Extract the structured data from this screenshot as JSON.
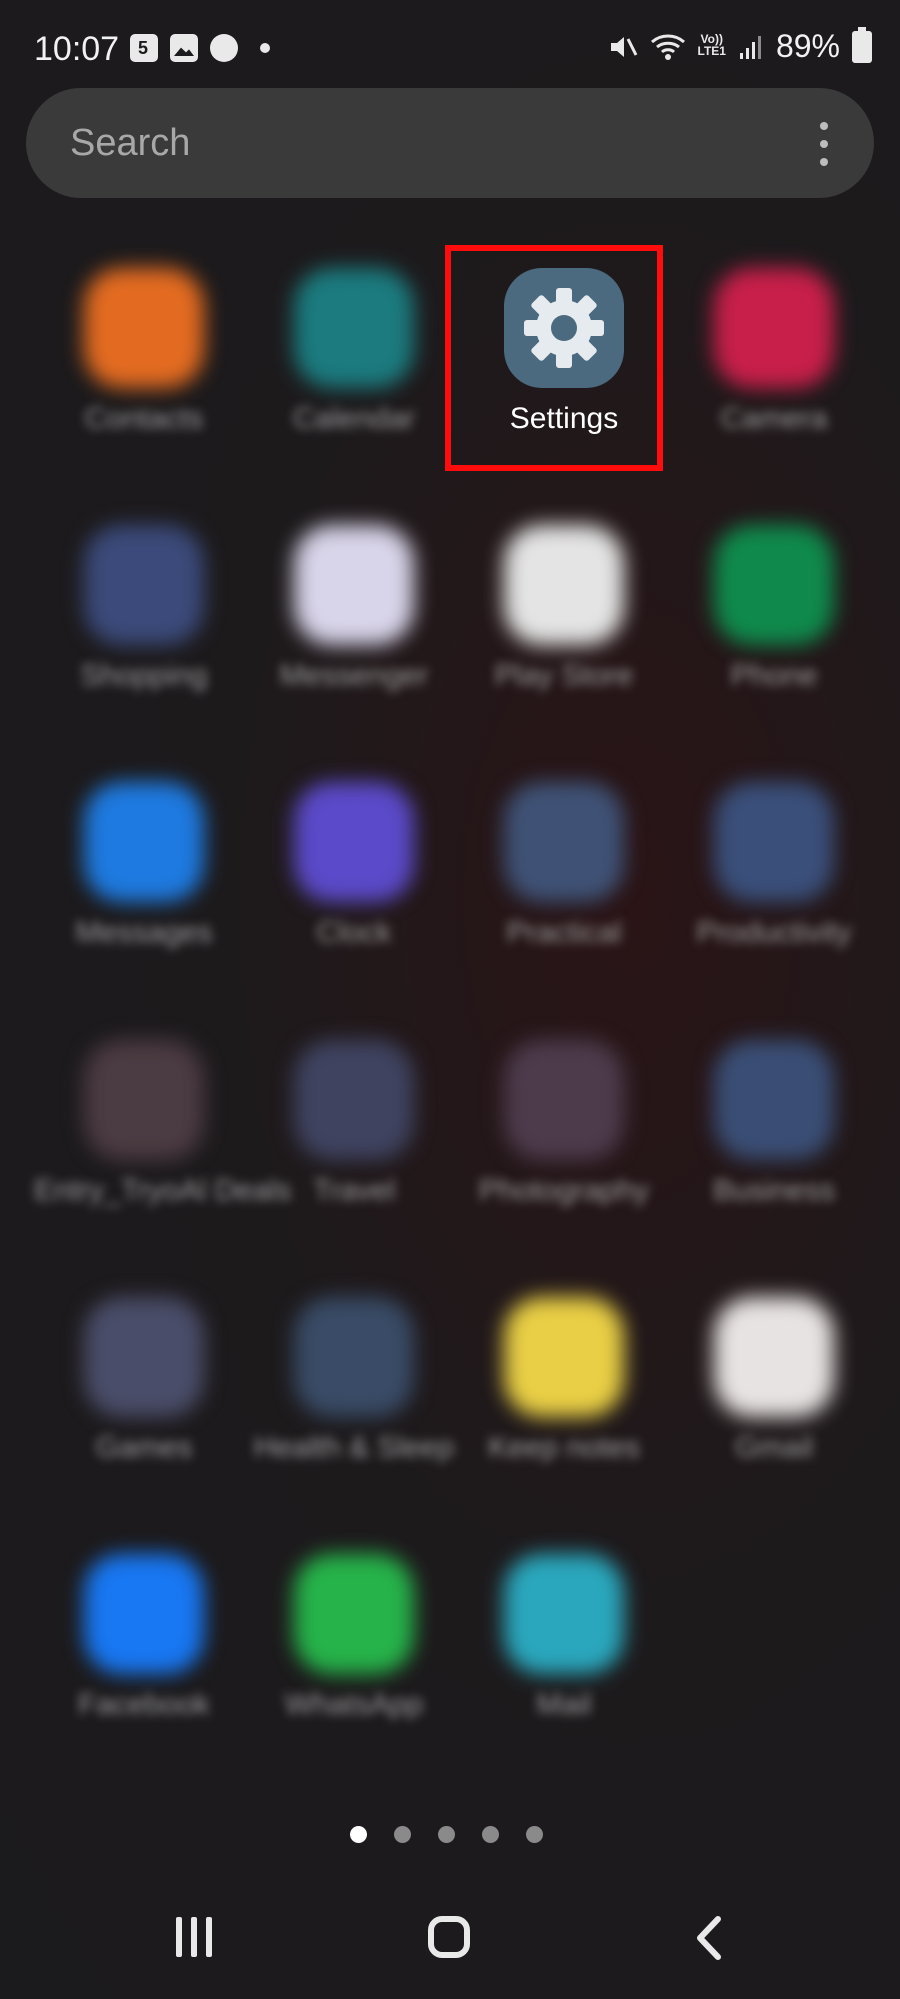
{
  "status_bar": {
    "time": "10:07",
    "calendar_day": "5",
    "lte_label_top": "Vo))",
    "lte_label_bottom": "LTE1",
    "battery": "89%"
  },
  "search": {
    "placeholder": "Search"
  },
  "apps": [
    {
      "label": "Contacts",
      "icon": "contacts-icon",
      "color": "#e36b21"
    },
    {
      "label": "Calendar",
      "icon": "calendar-icon",
      "color": "#1b7b7f"
    },
    {
      "label": "Settings",
      "icon": "gear-icon",
      "color": "#4b6a7f"
    },
    {
      "label": "Camera",
      "icon": "camera-icon",
      "color": "#c81f4a"
    },
    {
      "label": "Shopping",
      "icon": "folder-icon",
      "color": "#3b4a7a"
    },
    {
      "label": "Messenger",
      "icon": "messenger-icon",
      "color": "#d8d4e9"
    },
    {
      "label": "Play Store",
      "icon": "play-store-icon",
      "color": "#e4e4e4"
    },
    {
      "label": "Phone",
      "icon": "phone-icon",
      "color": "#0f8a4c"
    },
    {
      "label": "Messages",
      "icon": "messages-icon",
      "color": "#1e7ae0"
    },
    {
      "label": "Clock",
      "icon": "clock-icon",
      "color": "#5b4ac9"
    },
    {
      "label": "Practical",
      "icon": "folder-icon",
      "color": "#3f5276"
    },
    {
      "label": "Productivity",
      "icon": "folder-icon",
      "color": "#3a4f7a"
    },
    {
      "label": "Entry_TryoAl Deals",
      "icon": "folder-icon",
      "color": "#4b3b42"
    },
    {
      "label": "Travel",
      "icon": "folder-icon",
      "color": "#3f4360"
    },
    {
      "label": "Photography",
      "icon": "folder-icon",
      "color": "#4d3b4c"
    },
    {
      "label": "Business",
      "icon": "folder-icon",
      "color": "#3a4e75"
    },
    {
      "label": "Games",
      "icon": "folder-icon",
      "color": "#4a4d69"
    },
    {
      "label": "Health & Sleep",
      "icon": "folder-icon",
      "color": "#394b66"
    },
    {
      "label": "Keep notes",
      "icon": "notes-icon",
      "color": "#e9cf45"
    },
    {
      "label": "Gmail",
      "icon": "gmail-icon",
      "color": "#e7e3e3"
    },
    {
      "label": "Facebook",
      "icon": "facebook-icon",
      "color": "#1877f2"
    },
    {
      "label": "WhatsApp",
      "icon": "whatsapp-icon",
      "color": "#26b34a"
    },
    {
      "label": "Mail",
      "icon": "mail-icon",
      "color": "#2aa7bd"
    }
  ],
  "pager": {
    "pages": 5,
    "active": 0
  },
  "colors": {
    "highlight": "#ff0d0d",
    "search_bg": "#3a3a3b",
    "background": "#1b1a1c"
  }
}
